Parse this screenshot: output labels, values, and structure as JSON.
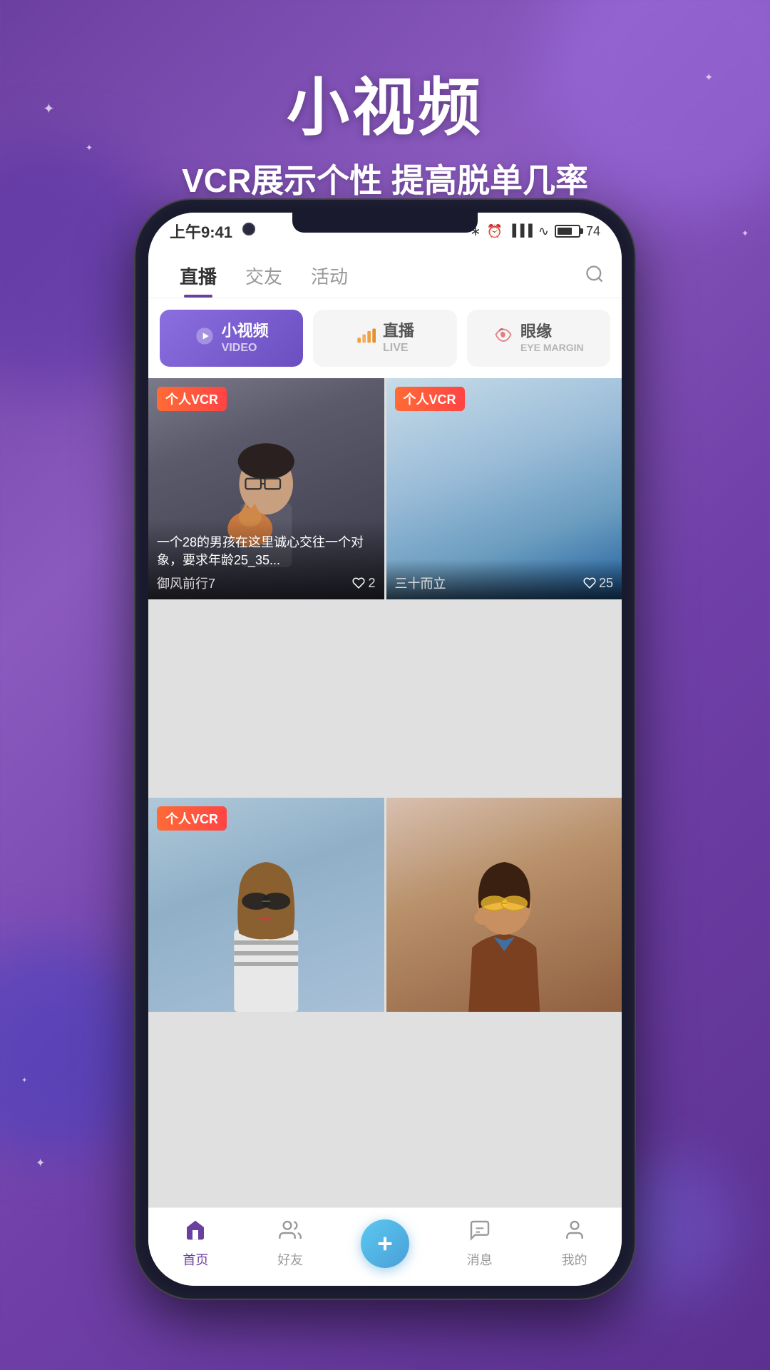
{
  "background": {
    "gradient_start": "#6b3fa0",
    "gradient_end": "#5b3090"
  },
  "header": {
    "title": "小视频",
    "subtitle": "VCR展示个性 提高脱单几率"
  },
  "status_bar": {
    "time": "上午9:41",
    "battery": "74",
    "icons": [
      "bluetooth",
      "alarm",
      "signal",
      "wifi",
      "battery"
    ]
  },
  "nav_tabs": [
    {
      "label": "直播",
      "active": true
    },
    {
      "label": "交友",
      "active": false
    },
    {
      "label": "活动",
      "active": false
    }
  ],
  "categories": [
    {
      "label": "小视频",
      "sublabel": "VIDEO",
      "icon": "▶",
      "active": true
    },
    {
      "label": "直播",
      "sublabel": "LIVE",
      "icon": "📊",
      "active": false
    },
    {
      "label": "眼缘",
      "sublabel": "EYE MARGIN",
      "icon": "🌸",
      "active": false
    }
  ],
  "videos": [
    {
      "id": "v1",
      "badge": "个人VCR",
      "title": "一个28的男孩在这里诚心交往一个对象，要求年龄25_35...",
      "user": "御风前行7",
      "likes": "2",
      "position": "left-top"
    },
    {
      "id": "v2",
      "badge": "个人VCR",
      "title": "",
      "user": "三十而立",
      "likes": "25",
      "position": "right-top"
    },
    {
      "id": "v3",
      "badge": "个人VCR",
      "title": "",
      "user": "",
      "likes": "",
      "position": "left-bottom"
    },
    {
      "id": "v4",
      "badge": "",
      "title": "",
      "user": "",
      "likes": "",
      "position": "right-bottom"
    }
  ],
  "bottom_nav": [
    {
      "label": "首页",
      "icon": "home",
      "active": true
    },
    {
      "label": "好友",
      "icon": "users",
      "active": false
    },
    {
      "label": "",
      "icon": "plus",
      "active": false,
      "is_add": true
    },
    {
      "label": "消息",
      "icon": "message",
      "active": false
    },
    {
      "label": "我的",
      "icon": "person",
      "active": false
    }
  ]
}
